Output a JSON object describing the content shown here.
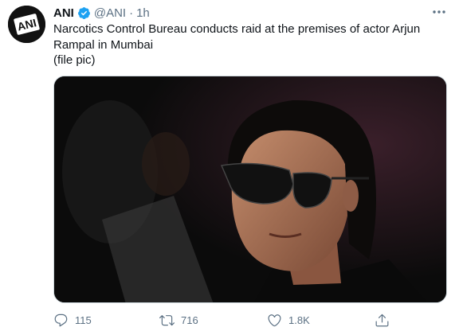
{
  "tweet": {
    "display_name": "ANI",
    "handle": "@ANI",
    "separator": "·",
    "time": "1h",
    "lines": [
      "Narcotics Control Bureau conducts raid at the premises of actor Arjun Rampal in Mumbai",
      "(file pic)"
    ],
    "avatar_label": "ANI",
    "icons": {
      "verified": "verified-badge-icon",
      "more": "more-options-icon",
      "reply": "reply-icon",
      "retweet": "retweet-icon",
      "like": "like-heart-icon",
      "share": "share-icon"
    },
    "colors": {
      "verified": "#1da1f2",
      "muted": "#5b7083",
      "text": "#0f1419"
    }
  },
  "stats": {
    "replies": "115",
    "retweets": "716",
    "likes": "1.8K"
  }
}
